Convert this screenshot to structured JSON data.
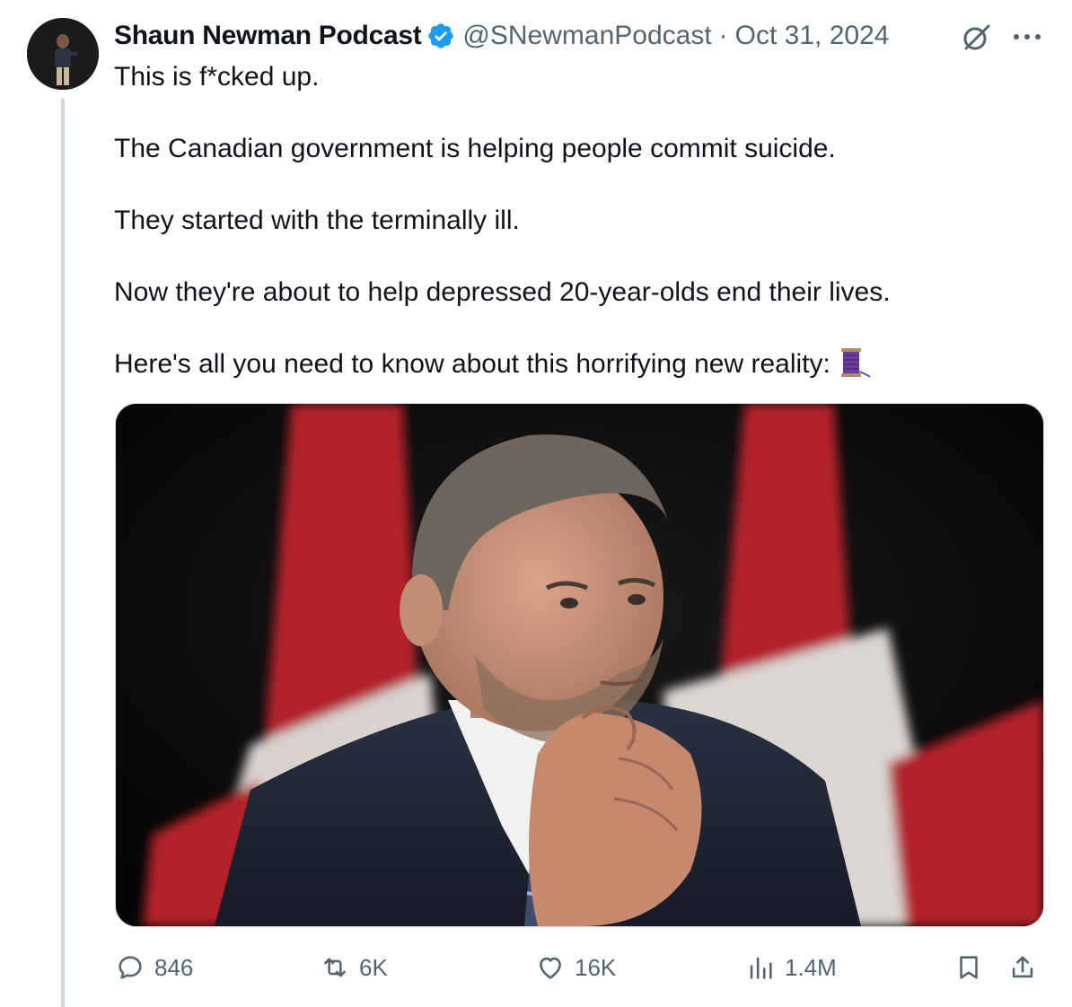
{
  "author": {
    "name": "Shaun Newman Podcast",
    "handle": "@SNewmanPodcast",
    "separator": "·",
    "date": "Oct 31, 2024",
    "avatar_icon": "avatar-photo",
    "verified_icon": "verified-badge-icon"
  },
  "tweet": {
    "lines": [
      "This is f*cked up.",
      "The Canadian government is helping people commit suicide.",
      "They started with the terminally ill.",
      "Now they're about to help depressed 20-year-olds end their lives.",
      "Here's all you need to know about this horrifying new reality:"
    ],
    "emoji_icon": "thread-spool-icon"
  },
  "media": {
    "icon": "photo-man-in-suit-with-canadian-flags"
  },
  "actions": {
    "replies": "846",
    "reposts": "6K",
    "likes": "16K",
    "views": "1.4M"
  },
  "colors": {
    "text": "#0f1419",
    "secondary": "#536471",
    "verified_blue": "#1d9bf0",
    "thread_line": "#cfd9de",
    "flag_red": "#c21e29"
  }
}
